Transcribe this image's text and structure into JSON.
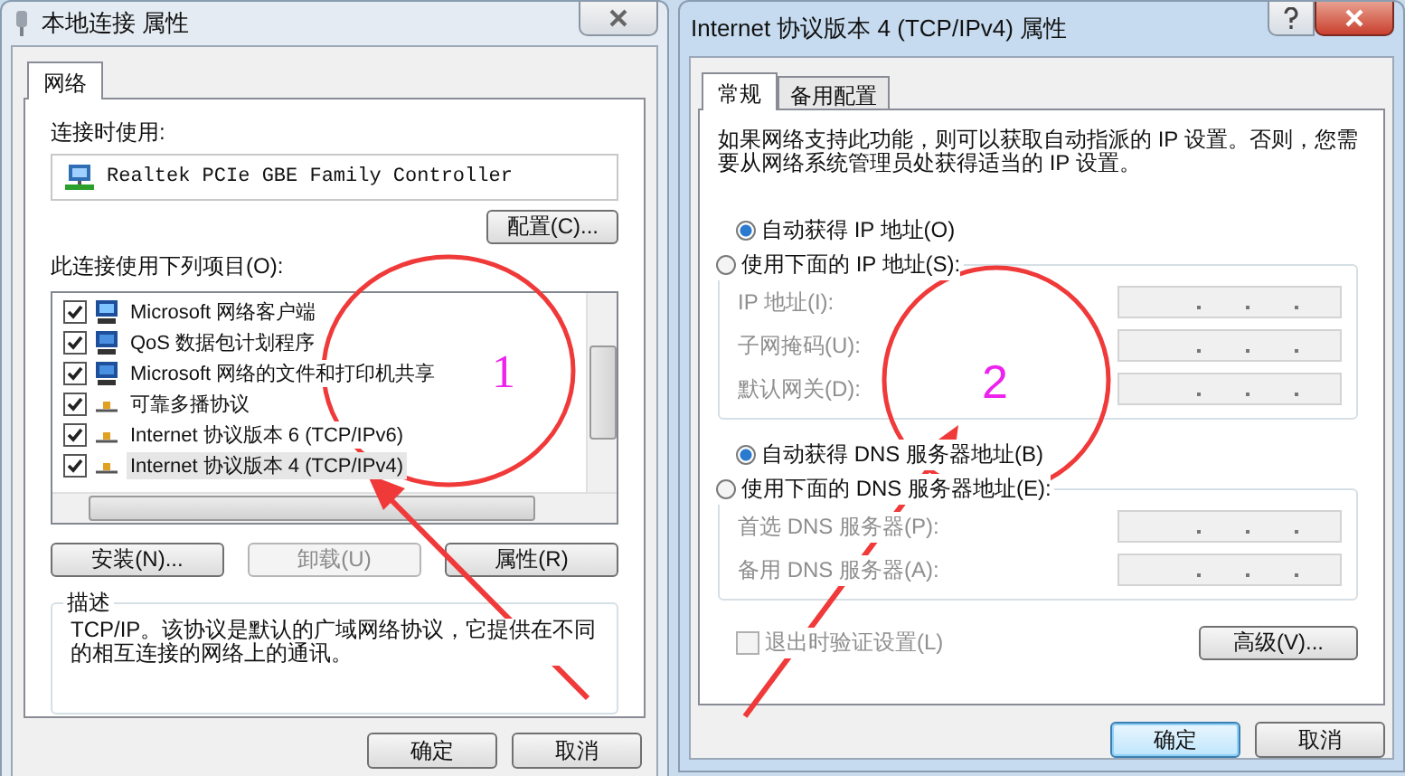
{
  "left_window": {
    "title": "本地连接 属性",
    "tabs": [
      {
        "label": "网络",
        "selected": true
      }
    ],
    "connect_using_label": "连接时使用:",
    "adapter": "Realtek PCIe GBE Family Controller",
    "configure_button": "配置(C)...",
    "items_label": "此连接使用下列项目(O):",
    "items": [
      {
        "label": "Microsoft 网络客户端",
        "checked": true,
        "selected": false,
        "kind": "client"
      },
      {
        "label": "QoS 数据包计划程序",
        "checked": true,
        "selected": false,
        "kind": "service"
      },
      {
        "label": "Microsoft 网络的文件和打印机共享",
        "checked": true,
        "selected": false,
        "kind": "service"
      },
      {
        "label": "可靠多播协议",
        "checked": true,
        "selected": false,
        "kind": "protocol"
      },
      {
        "label": "Internet 协议版本 6 (TCP/IPv6)",
        "checked": true,
        "selected": false,
        "kind": "protocol"
      },
      {
        "label": "Internet 协议版本 4 (TCP/IPv4)",
        "checked": true,
        "selected": true,
        "kind": "protocol"
      }
    ],
    "buttons": [
      {
        "label": "安装(N)...",
        "disabled": false
      },
      {
        "label": "卸载(U)",
        "disabled": true
      },
      {
        "label": "属性(R)",
        "disabled": false
      }
    ],
    "description": {
      "legend": "描述",
      "text": "TCP/IP。该协议是默认的广域网络协议，它提供在不同的相互连接的网络上的通讯。"
    },
    "footer_buttons": [
      {
        "label": "确定",
        "default": false
      },
      {
        "label": "取消",
        "default": false
      }
    ]
  },
  "right_window": {
    "title": "Internet 协议版本 4 (TCP/IPv4) 属性",
    "tabs": [
      {
        "label": "常规",
        "selected": true
      },
      {
        "label": "备用配置",
        "selected": false
      }
    ],
    "intro": "如果网络支持此功能，则可以获取自动指派的 IP 设置。否则，您需要从网络系统管理员处获得适当的 IP 设置。",
    "ip_auto": {
      "label": "自动获得 IP 地址(O)",
      "selected": true
    },
    "ip_manual": {
      "label": "使用下面的 IP 地址(S):",
      "selected": false
    },
    "ip_fields": [
      {
        "label": "IP 地址(I):",
        "disabled": true
      },
      {
        "label": "子网掩码(U):",
        "disabled": true
      },
      {
        "label": "默认网关(D):",
        "disabled": true
      }
    ],
    "dns_auto": {
      "label": "自动获得 DNS 服务器地址(B)",
      "selected": true
    },
    "dns_manual": {
      "label": "使用下面的 DNS 服务器地址(E):",
      "selected": false
    },
    "dns_fields": [
      {
        "label": "首选 DNS 服务器(P):",
        "disabled": true
      },
      {
        "label": "备用 DNS 服务器(A):",
        "disabled": true
      }
    ],
    "validate": {
      "label": "退出时验证设置(L)",
      "checked": false,
      "disabled": true
    },
    "advanced_button": "高级(V)...",
    "footer_buttons": [
      {
        "label": "确定",
        "default": true
      },
      {
        "label": "取消",
        "default": false
      }
    ]
  },
  "annotations": [
    {
      "label": "1"
    },
    {
      "label": "2"
    }
  ]
}
